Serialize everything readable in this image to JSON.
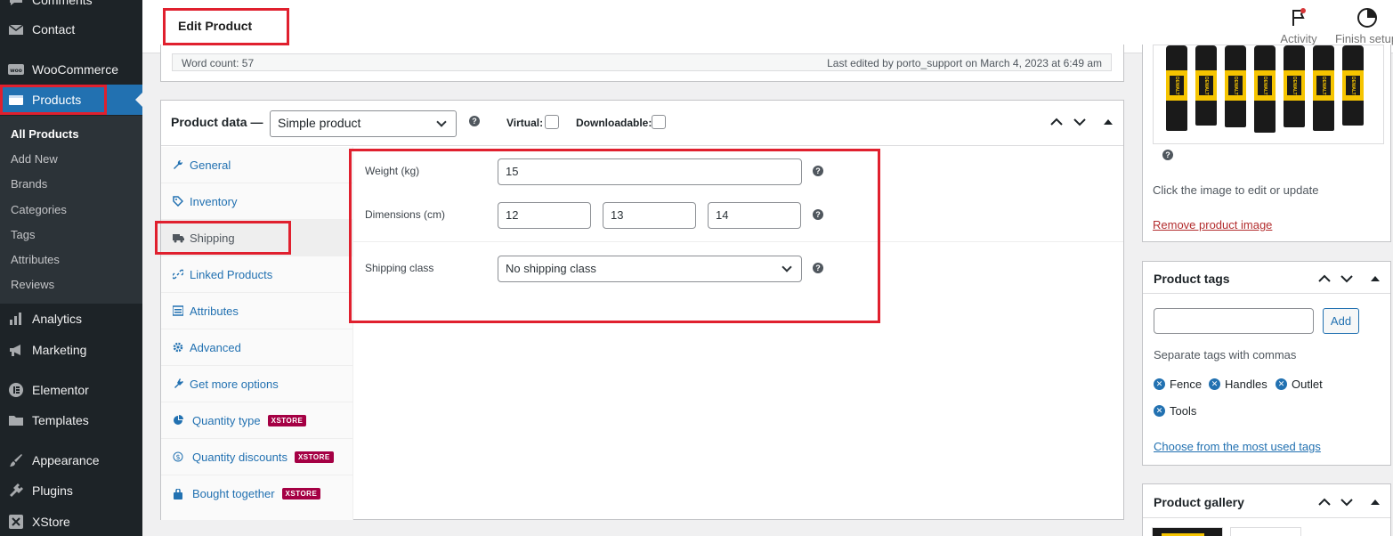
{
  "sidebar": {
    "items": [
      {
        "label": "Comments",
        "icon": "comments-icon"
      },
      {
        "label": "Contact",
        "icon": "mail-icon"
      },
      {
        "label": "WooCommerce",
        "icon": "woo-icon"
      },
      {
        "label": "Products",
        "icon": "products-icon"
      },
      {
        "label": "Analytics",
        "icon": "analytics-icon"
      },
      {
        "label": "Marketing",
        "icon": "megaphone-icon"
      },
      {
        "label": "Elementor",
        "icon": "elementor-icon"
      },
      {
        "label": "Templates",
        "icon": "folder-icon"
      },
      {
        "label": "Appearance",
        "icon": "brush-icon"
      },
      {
        "label": "Plugins",
        "icon": "plugin-icon"
      },
      {
        "label": "XStore",
        "icon": "xstore-icon"
      }
    ],
    "submenu": [
      "All Products",
      "Add New",
      "Brands",
      "Categories",
      "Tags",
      "Attributes",
      "Reviews"
    ]
  },
  "header": {
    "title": "Edit Product",
    "activity_label": "Activity",
    "finish_label": "Finish setup"
  },
  "wordcount": {
    "left": "Word count: 57",
    "right": "Last edited by porto_support on March 4, 2023 at 6:49 am"
  },
  "product_data": {
    "title": "Product data —",
    "type_value": "Simple product",
    "virtual_label": "Virtual:",
    "downloadable_label": "Downloadable:",
    "tabs": [
      {
        "label": "General",
        "icon": "wrench-icon",
        "badge": ""
      },
      {
        "label": "Inventory",
        "icon": "tag-icon",
        "badge": ""
      },
      {
        "label": "Shipping",
        "icon": "truck-icon",
        "badge": ""
      },
      {
        "label": "Linked Products",
        "icon": "link-icon",
        "badge": ""
      },
      {
        "label": "Attributes",
        "icon": "list-icon",
        "badge": ""
      },
      {
        "label": "Advanced",
        "icon": "gear-icon",
        "badge": ""
      },
      {
        "label": "Get more options",
        "icon": "plugin-icon",
        "badge": ""
      },
      {
        "label": "Quantity type",
        "icon": "pie-icon",
        "badge": "XSTORE"
      },
      {
        "label": "Quantity discounts",
        "icon": "dollar-icon",
        "badge": "XSTORE"
      },
      {
        "label": "Bought together",
        "icon": "bag-icon",
        "badge": "XSTORE"
      }
    ],
    "shipping": {
      "weight_label": "Weight (kg)",
      "weight_value": "15",
      "dimensions_label": "Dimensions (cm)",
      "length": "12",
      "width": "13",
      "height": "14",
      "class_label": "Shipping class",
      "class_value": "No shipping class"
    }
  },
  "product_image": {
    "edit_hint": "Click the image to edit or update",
    "remove_link": "Remove product image"
  },
  "product_tags": {
    "title": "Product tags",
    "add_label": "Add",
    "hint": "Separate tags with commas",
    "tags": [
      "Fence",
      "Handles",
      "Outlet",
      "Tools"
    ],
    "choose_link": "Choose from the most used tags"
  },
  "product_gallery": {
    "title": "Product gallery"
  },
  "colors": {
    "accent": "#2271b1",
    "highlight": "#e0202e",
    "xstore_badge": "#a50044"
  }
}
